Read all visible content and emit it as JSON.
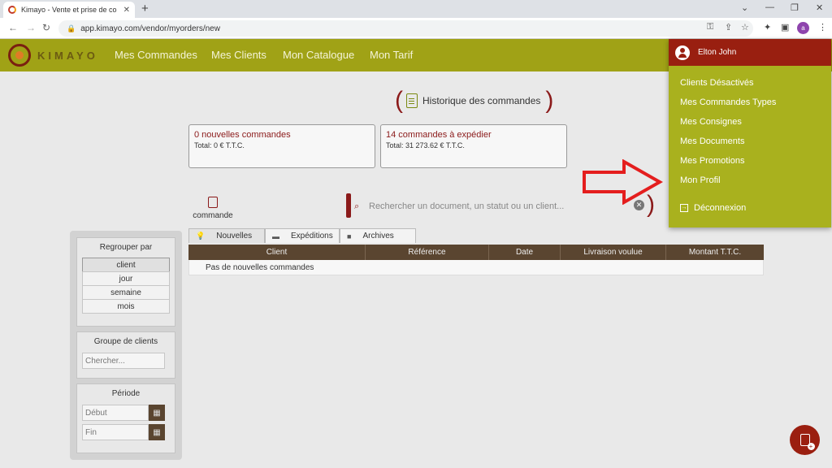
{
  "browser": {
    "tab_title": "Kimayo - Vente et prise de comm",
    "url": "app.kimayo.com/vendor/myorders/new",
    "profile_initial": "a",
    "icons": [
      "back-icon",
      "forward-icon",
      "reload-icon",
      "lock-icon",
      "key-icon",
      "share-icon",
      "star-icon",
      "extensions-icon",
      "sidebar-icon",
      "menu-icon"
    ]
  },
  "header": {
    "logo_text": "KIMAYO",
    "nav": [
      "Mes Commandes",
      "Mes Clients",
      "Mon Catalogue",
      "Mon Tarif"
    ]
  },
  "main": {
    "history_title": "Historique des commandes",
    "cards": [
      {
        "title": "0 nouvelles commandes",
        "total": "Total: 0 € T.T.C."
      },
      {
        "title": "14 commandes à expédier",
        "total": "Total: 31 273.62 € T.T.C."
      }
    ],
    "new_command_label": "commande",
    "search_placeholder": "Rechercher un document, un statut ou un client...",
    "tabs": [
      "Nouvelles",
      "Expéditions",
      "Archives"
    ],
    "table": {
      "columns": [
        "Client",
        "Référence",
        "Date",
        "Livraison voulue",
        "Montant T.T.C."
      ],
      "empty_message": "Pas de nouvelles commandes"
    }
  },
  "sidebar": {
    "group_title": "Regrouper par",
    "group_items": [
      "client",
      "jour",
      "semaine",
      "mois"
    ],
    "clients_title": "Groupe de clients",
    "clients_placeholder": "Chercher...",
    "period_title": "Période",
    "start_placeholder": "Début",
    "end_placeholder": "Fin"
  },
  "dropdown": {
    "user_name": "Elton John",
    "items": [
      "Clients Désactivés",
      "Mes Commandes Types",
      "Mes Consignes",
      "Mes Documents",
      "Mes Promotions",
      "Mon Profil"
    ],
    "logout": "Déconnexion"
  },
  "colors": {
    "header_bg": "#a0a216",
    "dropdown_bg": "#a9b11e",
    "dropdown_header_bg": "#991f10",
    "accent_red": "#8b1a1a",
    "table_header_bg": "#5a4530",
    "arrow": "#e41e1e"
  }
}
